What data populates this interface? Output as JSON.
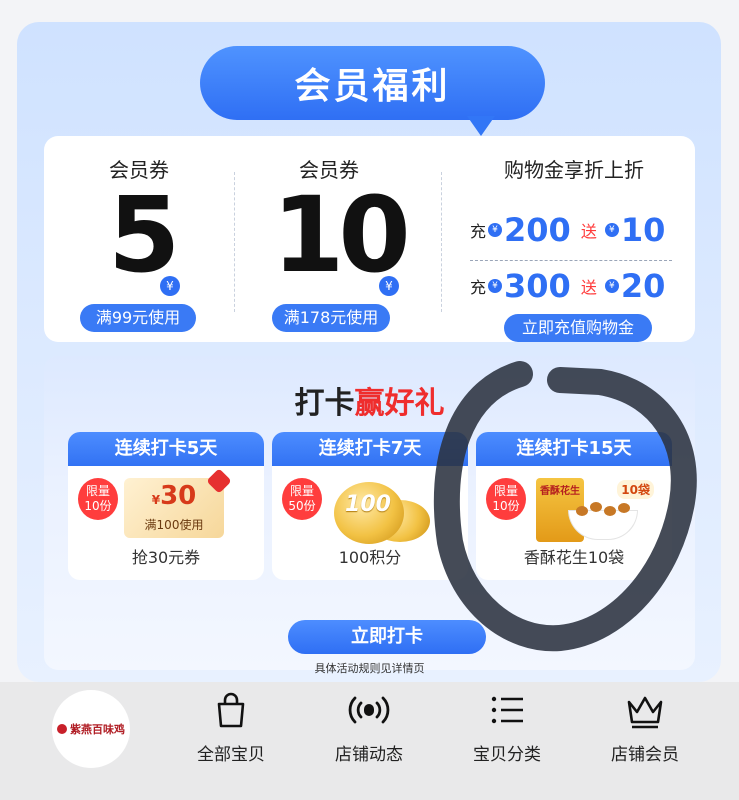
{
  "banner": {
    "title": "会员福利"
  },
  "coupons": [
    {
      "title": "会员券",
      "amount": "5",
      "yen": "¥",
      "condition": "满99元使用"
    },
    {
      "title": "会员券",
      "amount": "10",
      "yen": "¥",
      "condition": "满178元使用"
    }
  ],
  "shopping_gold": {
    "title": "购物金享折上折",
    "rows": [
      {
        "charge_label": "充",
        "charge_amount": "200",
        "give_label": "送",
        "give_amount": "10"
      },
      {
        "charge_label": "充",
        "charge_amount": "300",
        "give_label": "送",
        "give_amount": "20"
      }
    ],
    "yen": "¥",
    "button": "立即充值购物金"
  },
  "checkin": {
    "title_black": "打卡",
    "title_red": "赢好礼",
    "tiers": [
      {
        "head": "连续打卡5天",
        "limit_top": "限量",
        "limit_bottom": "10份",
        "ticket_value": "30",
        "ticket_yen": "¥",
        "ticket_cond": "满100使用",
        "label": "抢30元券"
      },
      {
        "head": "连续打卡7天",
        "limit_top": "限量",
        "limit_bottom": "50份",
        "coin_text": "100",
        "label": "100积分"
      },
      {
        "head": "连续打卡15天",
        "limit_top": "限量",
        "limit_bottom": "10份",
        "bag_text": "香酥花生",
        "bags_tag": "10袋",
        "label": "香酥花生10袋"
      }
    ],
    "button": "立即打卡",
    "rules": "具体活动规则见详情页"
  },
  "bottom_nav": {
    "logo_text": "紫燕百味鸡",
    "items": [
      {
        "label": "全部宝贝",
        "icon": "shopping-bag-icon"
      },
      {
        "label": "店铺动态",
        "icon": "broadcast-icon"
      },
      {
        "label": "宝贝分类",
        "icon": "list-icon"
      },
      {
        "label": "店铺会员",
        "icon": "crown-icon"
      }
    ]
  },
  "colors": {
    "accent": "#2f6ff4",
    "highlight": "#ef2d2d",
    "annotation": "#2b3240"
  }
}
